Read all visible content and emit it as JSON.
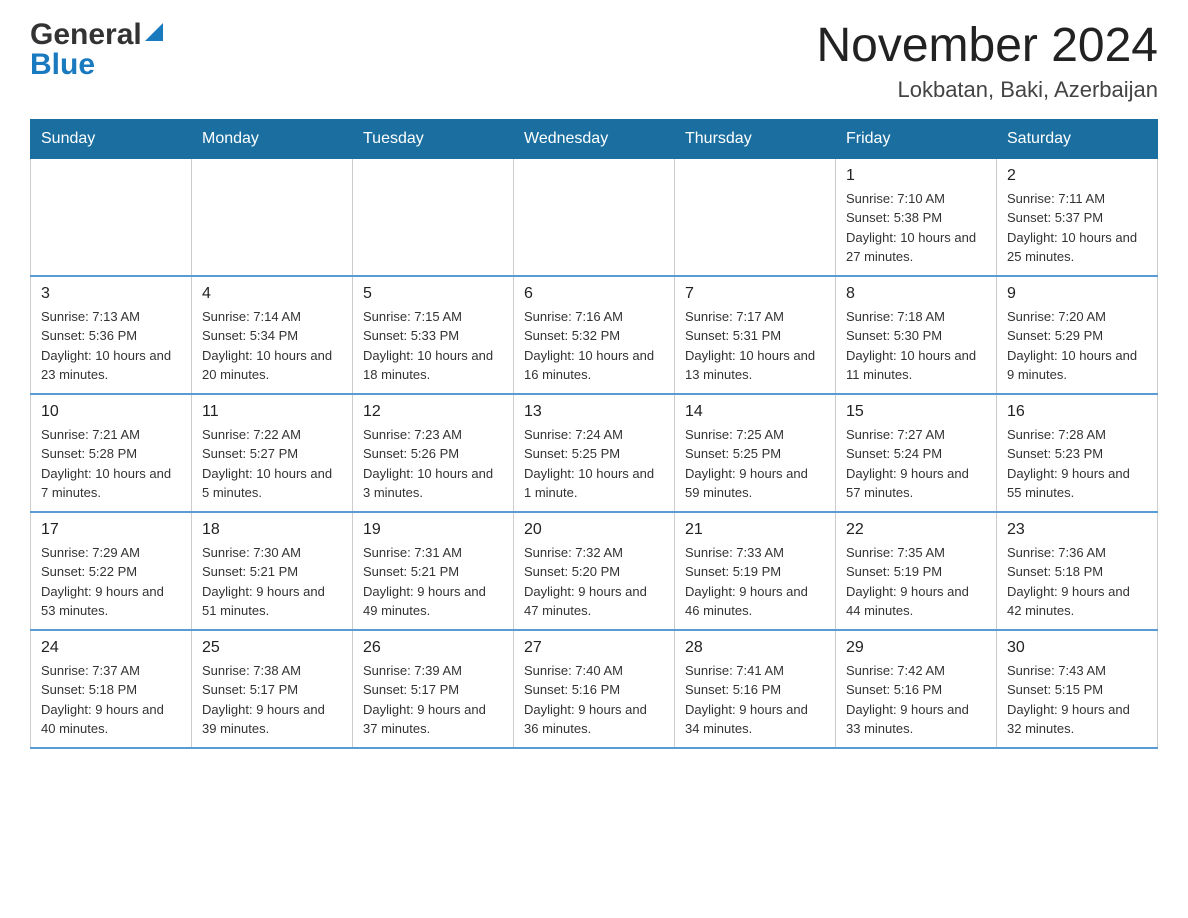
{
  "header": {
    "logo_general": "General",
    "logo_blue": "Blue",
    "title": "November 2024",
    "location": "Lokbatan, Baki, Azerbaijan"
  },
  "days_of_week": [
    "Sunday",
    "Monday",
    "Tuesday",
    "Wednesday",
    "Thursday",
    "Friday",
    "Saturday"
  ],
  "weeks": [
    [
      {
        "day": "",
        "info": ""
      },
      {
        "day": "",
        "info": ""
      },
      {
        "day": "",
        "info": ""
      },
      {
        "day": "",
        "info": ""
      },
      {
        "day": "",
        "info": ""
      },
      {
        "day": "1",
        "info": "Sunrise: 7:10 AM\nSunset: 5:38 PM\nDaylight: 10 hours and 27 minutes."
      },
      {
        "day": "2",
        "info": "Sunrise: 7:11 AM\nSunset: 5:37 PM\nDaylight: 10 hours and 25 minutes."
      }
    ],
    [
      {
        "day": "3",
        "info": "Sunrise: 7:13 AM\nSunset: 5:36 PM\nDaylight: 10 hours and 23 minutes."
      },
      {
        "day": "4",
        "info": "Sunrise: 7:14 AM\nSunset: 5:34 PM\nDaylight: 10 hours and 20 minutes."
      },
      {
        "day": "5",
        "info": "Sunrise: 7:15 AM\nSunset: 5:33 PM\nDaylight: 10 hours and 18 minutes."
      },
      {
        "day": "6",
        "info": "Sunrise: 7:16 AM\nSunset: 5:32 PM\nDaylight: 10 hours and 16 minutes."
      },
      {
        "day": "7",
        "info": "Sunrise: 7:17 AM\nSunset: 5:31 PM\nDaylight: 10 hours and 13 minutes."
      },
      {
        "day": "8",
        "info": "Sunrise: 7:18 AM\nSunset: 5:30 PM\nDaylight: 10 hours and 11 minutes."
      },
      {
        "day": "9",
        "info": "Sunrise: 7:20 AM\nSunset: 5:29 PM\nDaylight: 10 hours and 9 minutes."
      }
    ],
    [
      {
        "day": "10",
        "info": "Sunrise: 7:21 AM\nSunset: 5:28 PM\nDaylight: 10 hours and 7 minutes."
      },
      {
        "day": "11",
        "info": "Sunrise: 7:22 AM\nSunset: 5:27 PM\nDaylight: 10 hours and 5 minutes."
      },
      {
        "day": "12",
        "info": "Sunrise: 7:23 AM\nSunset: 5:26 PM\nDaylight: 10 hours and 3 minutes."
      },
      {
        "day": "13",
        "info": "Sunrise: 7:24 AM\nSunset: 5:25 PM\nDaylight: 10 hours and 1 minute."
      },
      {
        "day": "14",
        "info": "Sunrise: 7:25 AM\nSunset: 5:25 PM\nDaylight: 9 hours and 59 minutes."
      },
      {
        "day": "15",
        "info": "Sunrise: 7:27 AM\nSunset: 5:24 PM\nDaylight: 9 hours and 57 minutes."
      },
      {
        "day": "16",
        "info": "Sunrise: 7:28 AM\nSunset: 5:23 PM\nDaylight: 9 hours and 55 minutes."
      }
    ],
    [
      {
        "day": "17",
        "info": "Sunrise: 7:29 AM\nSunset: 5:22 PM\nDaylight: 9 hours and 53 minutes."
      },
      {
        "day": "18",
        "info": "Sunrise: 7:30 AM\nSunset: 5:21 PM\nDaylight: 9 hours and 51 minutes."
      },
      {
        "day": "19",
        "info": "Sunrise: 7:31 AM\nSunset: 5:21 PM\nDaylight: 9 hours and 49 minutes."
      },
      {
        "day": "20",
        "info": "Sunrise: 7:32 AM\nSunset: 5:20 PM\nDaylight: 9 hours and 47 minutes."
      },
      {
        "day": "21",
        "info": "Sunrise: 7:33 AM\nSunset: 5:19 PM\nDaylight: 9 hours and 46 minutes."
      },
      {
        "day": "22",
        "info": "Sunrise: 7:35 AM\nSunset: 5:19 PM\nDaylight: 9 hours and 44 minutes."
      },
      {
        "day": "23",
        "info": "Sunrise: 7:36 AM\nSunset: 5:18 PM\nDaylight: 9 hours and 42 minutes."
      }
    ],
    [
      {
        "day": "24",
        "info": "Sunrise: 7:37 AM\nSunset: 5:18 PM\nDaylight: 9 hours and 40 minutes."
      },
      {
        "day": "25",
        "info": "Sunrise: 7:38 AM\nSunset: 5:17 PM\nDaylight: 9 hours and 39 minutes."
      },
      {
        "day": "26",
        "info": "Sunrise: 7:39 AM\nSunset: 5:17 PM\nDaylight: 9 hours and 37 minutes."
      },
      {
        "day": "27",
        "info": "Sunrise: 7:40 AM\nSunset: 5:16 PM\nDaylight: 9 hours and 36 minutes."
      },
      {
        "day": "28",
        "info": "Sunrise: 7:41 AM\nSunset: 5:16 PM\nDaylight: 9 hours and 34 minutes."
      },
      {
        "day": "29",
        "info": "Sunrise: 7:42 AM\nSunset: 5:16 PM\nDaylight: 9 hours and 33 minutes."
      },
      {
        "day": "30",
        "info": "Sunrise: 7:43 AM\nSunset: 5:15 PM\nDaylight: 9 hours and 32 minutes."
      }
    ]
  ]
}
